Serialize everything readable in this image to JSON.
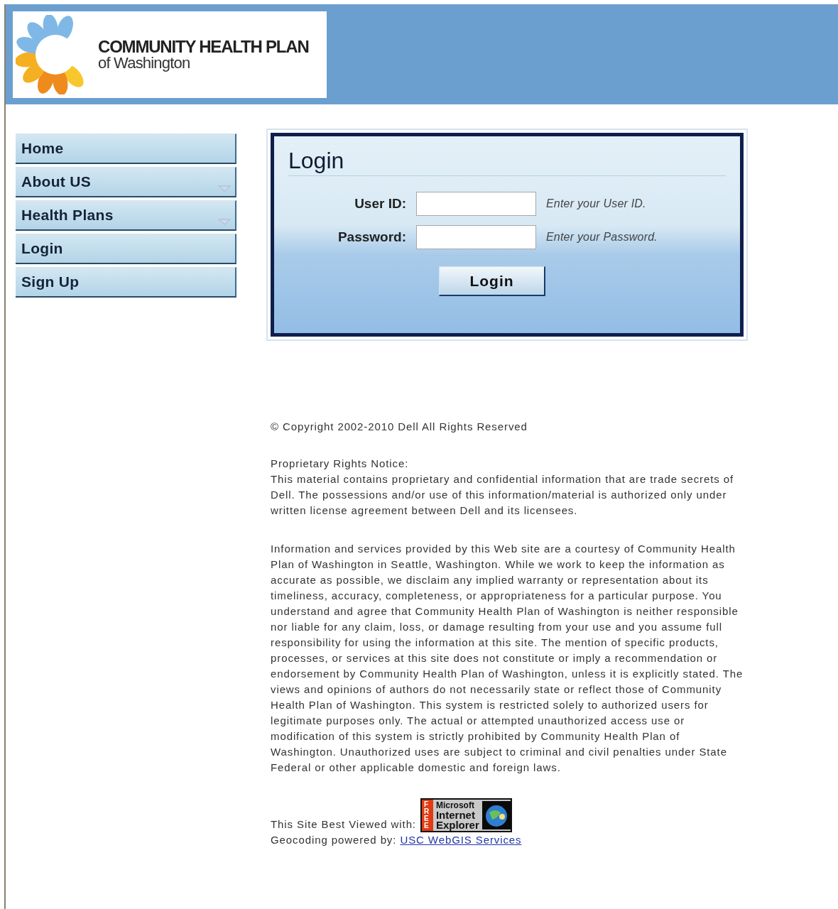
{
  "header": {
    "logo": {
      "title": "COMMUNITY HEALTH PLAN",
      "subtitle": "of Washington"
    }
  },
  "nav": [
    {
      "label": "Home",
      "has_submenu": false
    },
    {
      "label": "About US",
      "has_submenu": true
    },
    {
      "label": "Health Plans",
      "has_submenu": true
    },
    {
      "label": "Login",
      "has_submenu": false
    },
    {
      "label": "Sign Up",
      "has_submenu": false
    }
  ],
  "login": {
    "title": "Login",
    "fields": [
      {
        "label": "User ID:",
        "hint": "Enter your User ID."
      },
      {
        "label": "Password:",
        "hint": "Enter your Password."
      }
    ],
    "button": "Login"
  },
  "footer": {
    "copyright": "© Copyright 2002-2010 Dell All Rights Reserved",
    "notice_title": "Proprietary Rights Notice:",
    "notice": "This material contains proprietary and confidential information that are trade secrets of Dell. The possessions and/or use of this information/material is authorized only under written license agreement between Dell and its licensees.",
    "disclaimer": "Information and services provided by this Web site are a courtesy of Community Health Plan of Washington in Seattle, Washington. While we work to keep the information as accurate as possible, we disclaim any implied warranty or representation about its timeliness, accuracy, completeness, or appropriateness for a particular purpose. You understand and agree that Community Health Plan of Washington is neither responsible nor liable for any claim, loss, or damage resulting from your use and you assume full responsibility for using the information at this site. The mention of specific products, processes, or services at this site does not constitute or imply a recommendation or endorsement by Community Health Plan of Washington, unless it is explicitly stated. The views and opinions of authors do not necessarily state or reflect those of Community Health Plan of Washington. This system is restricted solely to authorized users for legitimate purposes only. The actual or attempted unauthorized access use or modification of this system is strictly prohibited by Community Health Plan of Washington. Unauthorized uses are subject to criminal and civil penalties under State Federal or other applicable domestic and foreign laws.",
    "best_viewed": "This Site Best Viewed with:",
    "browser_badge": {
      "ribbon": "FREE",
      "line_1": "Microsoft",
      "line_2": "Internet",
      "line_3": "Explorer"
    },
    "geocoding_label": "Geocoding powered by:",
    "geocoding_link": "USC WebGIS Services"
  }
}
